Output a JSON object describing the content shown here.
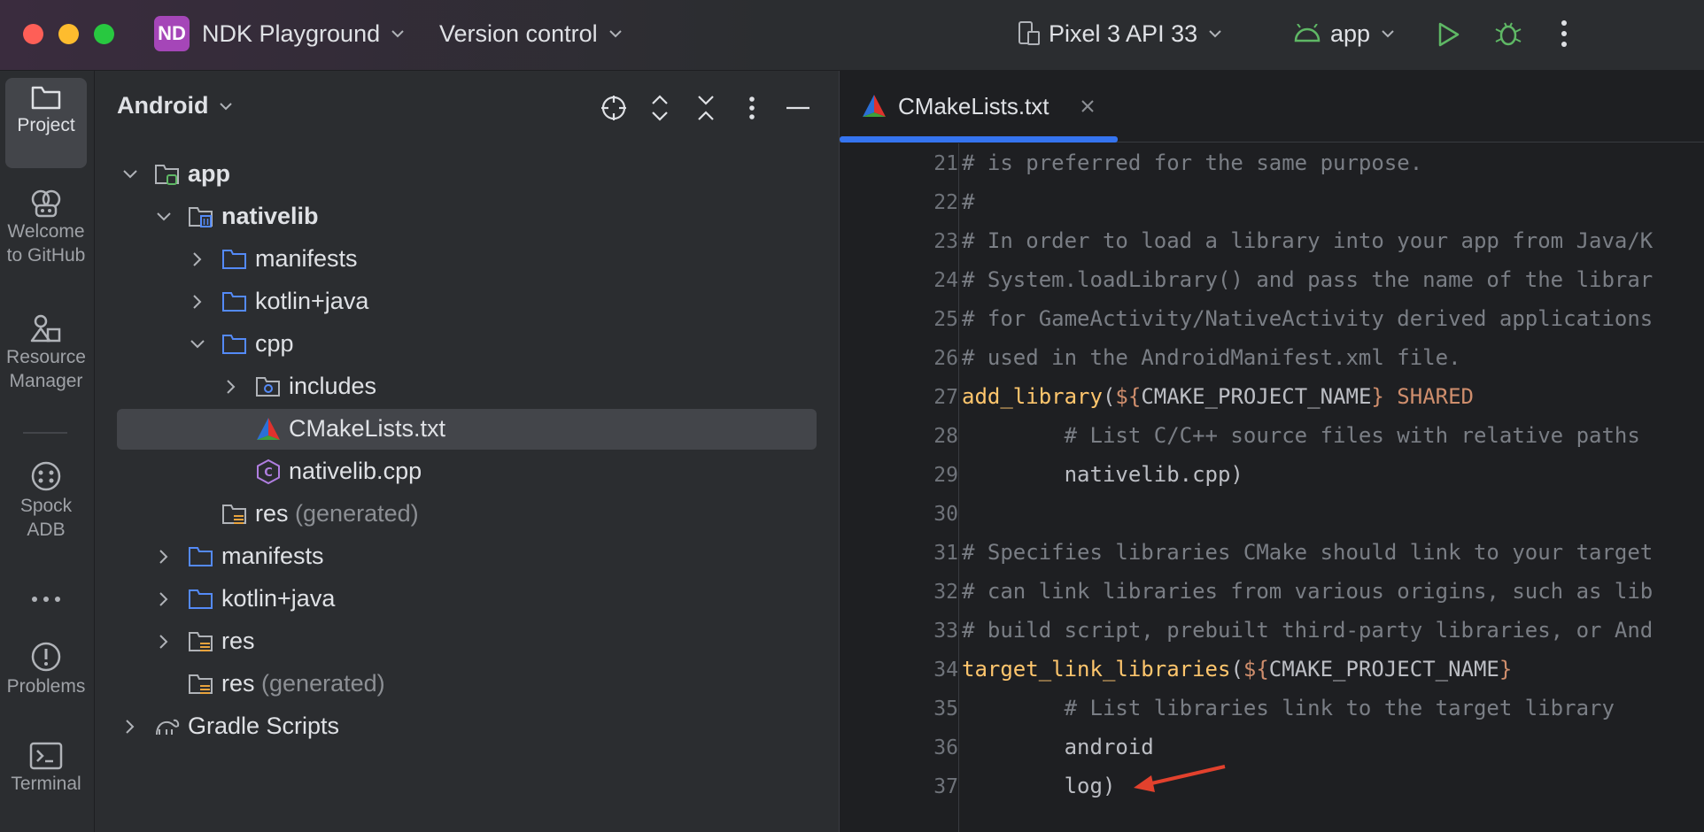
{
  "window": {
    "project_badge": "ND",
    "project_name": "NDK Playground",
    "vcs_label": "Version control",
    "device_label": "Pixel 3 API 33",
    "run_config": "app"
  },
  "stripe": {
    "items": [
      {
        "label": "Project"
      },
      {
        "label": "Welcome to GitHub"
      },
      {
        "label": "Resource Manager"
      },
      {
        "label": "Spock ADB"
      },
      {
        "label": "Problems"
      },
      {
        "label": "Terminal"
      }
    ]
  },
  "project_panel": {
    "view_mode": "Android",
    "tree": [
      {
        "label": "app",
        "suffix": ""
      },
      {
        "label": "nativelib",
        "suffix": ""
      },
      {
        "label": "manifests",
        "suffix": ""
      },
      {
        "label": "kotlin+java",
        "suffix": ""
      },
      {
        "label": "cpp",
        "suffix": ""
      },
      {
        "label": "includes",
        "suffix": ""
      },
      {
        "label": "CMakeLists.txt",
        "suffix": ""
      },
      {
        "label": "nativelib.cpp",
        "suffix": ""
      },
      {
        "label": "res",
        "suffix": "(generated)"
      },
      {
        "label": "manifests",
        "suffix": ""
      },
      {
        "label": "kotlin+java",
        "suffix": ""
      },
      {
        "label": "res",
        "suffix": ""
      },
      {
        "label": "res",
        "suffix": "(generated)"
      },
      {
        "label": "Gradle Scripts",
        "suffix": ""
      }
    ]
  },
  "editor": {
    "tab_label": "CMakeLists.txt",
    "lines": [
      {
        "n": "21",
        "text": "# is preferred for the same purpose."
      },
      {
        "n": "22",
        "text": "#"
      },
      {
        "n": "23",
        "text": "# In order to load a library into your app from Java/K"
      },
      {
        "n": "24",
        "text": "# System.loadLibrary() and pass the name of the librar"
      },
      {
        "n": "25",
        "text": "# for GameActivity/NativeActivity derived applications"
      },
      {
        "n": "26",
        "text": "# used in the AndroidManifest.xml file."
      },
      {
        "n": "27",
        "fn": "add_library",
        "p1": "(",
        "v1": "${",
        "name": "CMAKE_PROJECT_NAME",
        "v2": "}",
        "kw": " SHARED"
      },
      {
        "n": "28",
        "text": "        # List C/C++ source files with relative paths"
      },
      {
        "n": "29",
        "text": "        nativelib.cpp)"
      },
      {
        "n": "30",
        "text": ""
      },
      {
        "n": "31",
        "text": "# Specifies libraries CMake should link to your target"
      },
      {
        "n": "32",
        "text": "# can link libraries from various origins, such as lib"
      },
      {
        "n": "33",
        "text": "# build script, prebuilt third-party libraries, or And"
      },
      {
        "n": "34",
        "fn": "target_link_libraries",
        "p1": "(",
        "v1": "${",
        "name": "CMAKE_PROJECT_NAME",
        "v2": "}"
      },
      {
        "n": "35",
        "text": "        # List libraries link to the target library"
      },
      {
        "n": "36",
        "text": "        android"
      },
      {
        "n": "37",
        "text": "        log)"
      }
    ]
  },
  "colors": {
    "accent": "#3574f0",
    "annotation_arrow": "#e2412d",
    "comment": "#7a7e85",
    "function": "#ffc66d",
    "keyword": "#cf8e6d",
    "variable": "#c77dbb"
  }
}
